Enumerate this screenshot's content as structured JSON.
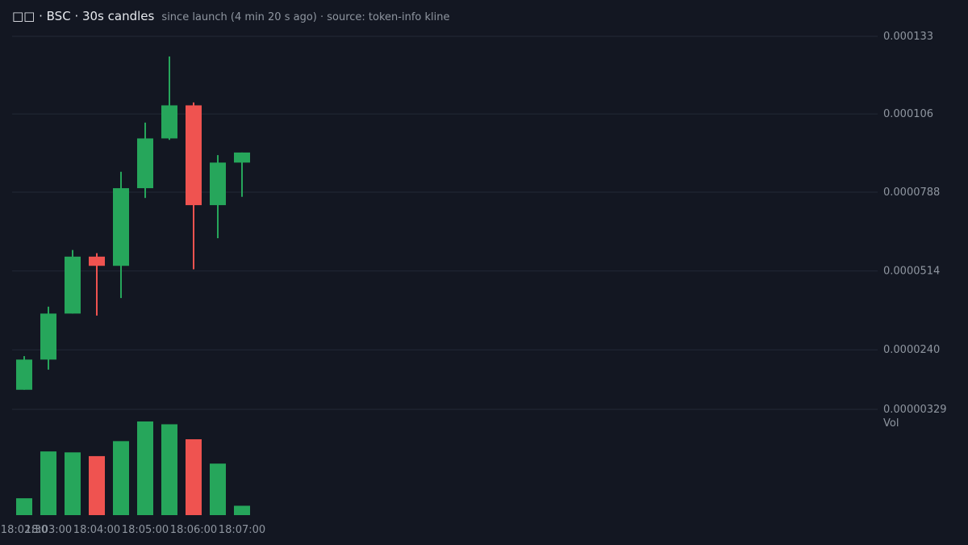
{
  "header": {
    "title": "□□ · BSC · 30s candles",
    "subtitle": "since launch (4 min 20 s ago) · source: token-info kline"
  },
  "colors": {
    "background": "#131722",
    "up": "#26a65b",
    "down": "#ef5350",
    "grid": "#232836",
    "text": "#8f96a0"
  },
  "chart_data": {
    "type": "candlestick",
    "price_axis": {
      "ticks": [
        0.000133,
        0.000106,
        7.88e-05,
        5.14e-05,
        2.4e-05,
        3.29e-06
      ],
      "tick_labels": [
        "0.000133",
        "0.000106",
        "0.0000788",
        "0.0000514",
        "0.0000240",
        "0.00000329"
      ],
      "range": [
        3.29e-06,
        0.000133
      ]
    },
    "volume_label": "Vol",
    "time_labels": [
      {
        "t": 0,
        "label": "18:02:30"
      },
      {
        "t": 1,
        "label": "18:03:00"
      },
      {
        "t": 3,
        "label": "18:04:00"
      },
      {
        "t": 5,
        "label": "18:05:00"
      },
      {
        "t": 7,
        "label": "18:06:00"
      },
      {
        "t": 9,
        "label": "18:07:00"
      }
    ],
    "candles": [
      {
        "time": "18:02:30",
        "open": 1.01e-05,
        "high": 2.18e-05,
        "low": 1.01e-05,
        "close": 2.06e-05,
        "volume": 18
      },
      {
        "time": "18:03:00",
        "open": 2.06e-05,
        "high": 3.9e-05,
        "low": 1.71e-05,
        "close": 3.66e-05,
        "volume": 68
      },
      {
        "time": "18:03:30",
        "open": 3.66e-05,
        "high": 5.87e-05,
        "low": 3.66e-05,
        "close": 5.64e-05,
        "volume": 67
      },
      {
        "time": "18:04:00",
        "open": 5.64e-05,
        "high": 5.76e-05,
        "low": 3.59e-05,
        "close": 5.32e-05,
        "volume": 63
      },
      {
        "time": "18:04:30",
        "open": 5.32e-05,
        "high": 8.59e-05,
        "low": 4.2e-05,
        "close": 8.02e-05,
        "volume": 79
      },
      {
        "time": "18:05:00",
        "open": 8.02e-05,
        "high": 0.000103,
        "low": 7.68e-05,
        "close": 9.75e-05,
        "volume": 100
      },
      {
        "time": "18:05:30",
        "open": 9.75e-05,
        "high": 0.000126,
        "low": 9.7e-05,
        "close": 0.000109,
        "volume": 97
      },
      {
        "time": "18:06:00",
        "open": 0.000109,
        "high": 0.00011,
        "low": 5.2e-05,
        "close": 7.43e-05,
        "volume": 81
      },
      {
        "time": "18:06:30",
        "open": 7.43e-05,
        "high": 9.17e-05,
        "low": 6.28e-05,
        "close": 8.91e-05,
        "volume": 55
      },
      {
        "time": "18:07:00",
        "open": 8.91e-05,
        "high": 9.26e-05,
        "low": 7.72e-05,
        "close": 9.26e-05,
        "volume": 10
      }
    ]
  }
}
